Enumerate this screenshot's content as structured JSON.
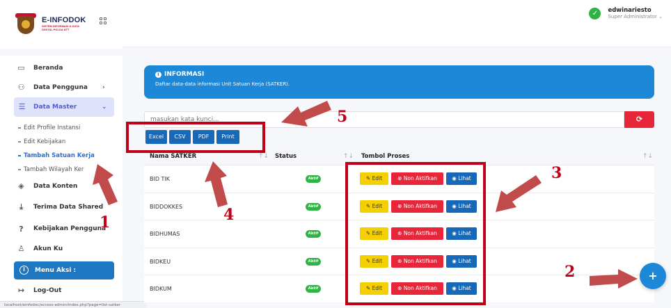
{
  "brand": {
    "title": "E-INFODOK",
    "subtitle": "SISTEM INFORMASI & DATA DIGITAL POLDA NTT"
  },
  "user": {
    "name": "edwinariesto",
    "role": "Super Administrator ⌄"
  },
  "nav": {
    "beranda": "Beranda",
    "data_pengguna": "Data Pengguna",
    "data_master": "Data Master",
    "sub": [
      "Edit Profile Instansi",
      "Edit Kebijakan",
      "Tambah Satuan Kerja",
      "Tambah Wilayah Ker"
    ],
    "data_konten": "Data Konten",
    "terima_data": "Terima Data Shared",
    "kebijakan": "Kebijakan Pengguna",
    "akun": "Akun Ku",
    "menu_aksi": "Menu Aksi :",
    "logout": "Log-Out"
  },
  "status_url": "localhost/einfodoc/access-admin/index.php?page=list-satker",
  "info": {
    "title": "INFORMASI",
    "desc": "Daftar data-data informasi Unit Satuan Kerja (SATKER)."
  },
  "search": {
    "placeholder": "masukan kata kunci..."
  },
  "export": {
    "excel": "Excel",
    "csv": "CSV",
    "pdf": "PDF",
    "print": "Print"
  },
  "table": {
    "headers": {
      "name": "Nama SATKER",
      "status": "Status",
      "actions": "Tombol Proses"
    },
    "rows": [
      {
        "name": "BID TIK",
        "status": "Aktif"
      },
      {
        "name": "BIDDOKKES",
        "status": "Aktif"
      },
      {
        "name": "BIDHUMAS",
        "status": "Aktif"
      },
      {
        "name": "BIDKEU",
        "status": "Aktif"
      },
      {
        "name": "BIDKUM",
        "status": "Aktif"
      }
    ],
    "edit_label": "Edit",
    "non_label": "Non Aktifkan",
    "lihat_label": "Lihat"
  },
  "fab": {
    "label": "+"
  },
  "annotations": {
    "n1": "1",
    "n2": "2",
    "n3": "3",
    "n4": "4",
    "n5": "5"
  },
  "colors": {
    "accent": "#1d87d8",
    "danger": "#e8263a",
    "warning": "#f4d000",
    "success": "#2fb344",
    "annotation": "#c00018"
  }
}
